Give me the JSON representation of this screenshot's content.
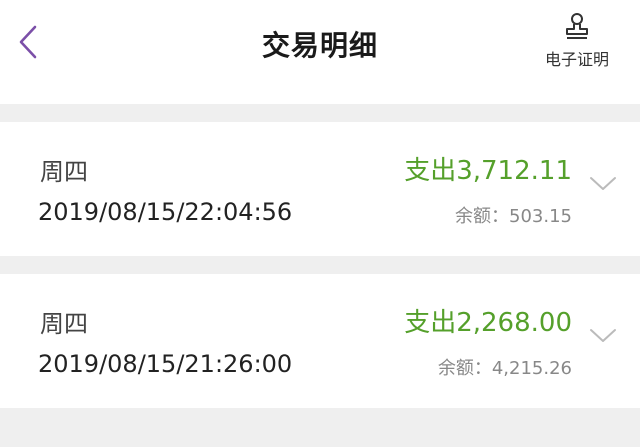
{
  "header": {
    "title": "交易明细",
    "cert_label": "电子证明",
    "accent_color": "#7b4fa8"
  },
  "transactions": [
    {
      "weekday": "周四",
      "datetime": "2019/08/15/22:04:56",
      "amount": "支出3,712.11",
      "balance": "余额：503.15"
    },
    {
      "weekday": "周四",
      "datetime": "2019/08/15/21:26:00",
      "amount": "支出2,268.00",
      "balance": "余额：4,215.26"
    }
  ],
  "colors": {
    "amount": "#55a02b",
    "background": "#efefef"
  },
  "icons": {
    "back": "chevron-left-icon",
    "cert": "stamp-icon",
    "expand": "chevron-down-icon"
  }
}
